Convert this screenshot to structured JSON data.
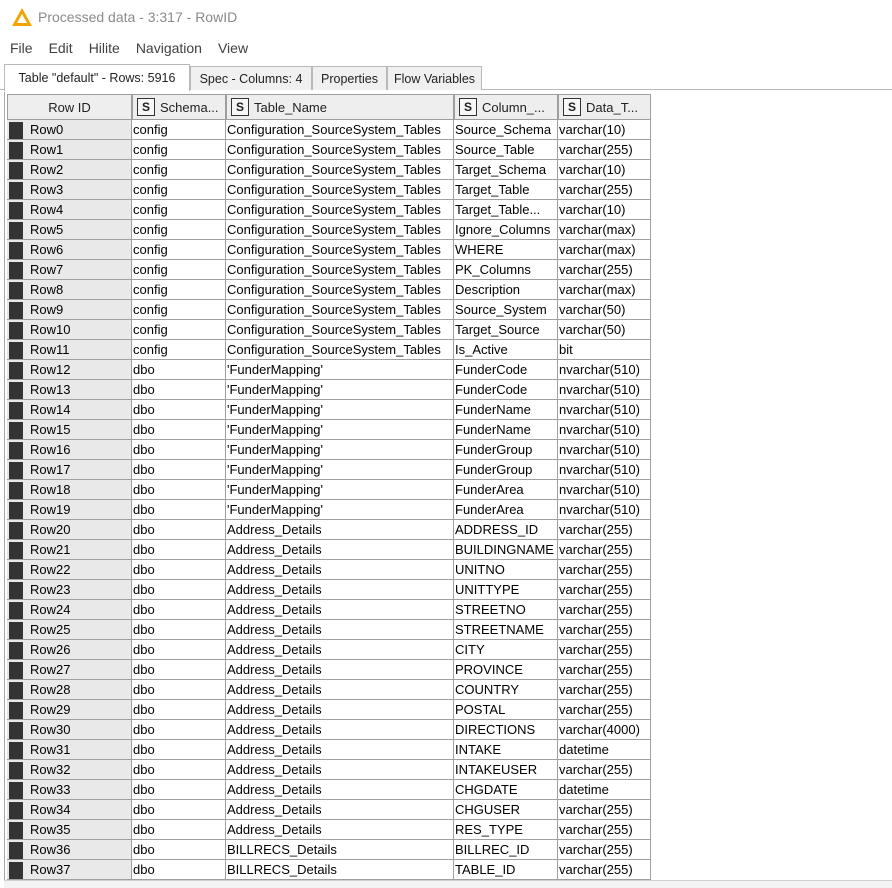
{
  "window": {
    "title": "Processed data - 3:317 - RowID",
    "warning_icon_color": "#f0a500"
  },
  "menu": [
    "File",
    "Edit",
    "Hilite",
    "Navigation",
    "View"
  ],
  "tabs": [
    {
      "label": "Table \"default\" - Rows: 5916",
      "active": true
    },
    {
      "label": "Spec - Columns: 4",
      "active": false
    },
    {
      "label": "Properties",
      "active": false
    },
    {
      "label": "Flow Variables",
      "active": false
    }
  ],
  "table": {
    "row_id_header": "Row ID",
    "columns": [
      {
        "type_badge": "S",
        "label": "Schema..."
      },
      {
        "type_badge": "S",
        "label": "Table_Name"
      },
      {
        "type_badge": "S",
        "label": "Column_..."
      },
      {
        "type_badge": "S",
        "label": "Data_T..."
      }
    ],
    "rows": [
      [
        "Row0",
        "config",
        "Configuration_SourceSystem_Tables",
        "Source_Schema",
        "varchar(10)"
      ],
      [
        "Row1",
        "config",
        "Configuration_SourceSystem_Tables",
        "Source_Table",
        "varchar(255)"
      ],
      [
        "Row2",
        "config",
        "Configuration_SourceSystem_Tables",
        "Target_Schema",
        "varchar(10)"
      ],
      [
        "Row3",
        "config",
        "Configuration_SourceSystem_Tables",
        "Target_Table",
        "varchar(255)"
      ],
      [
        "Row4",
        "config",
        "Configuration_SourceSystem_Tables",
        "Target_Table...",
        "varchar(10)"
      ],
      [
        "Row5",
        "config",
        "Configuration_SourceSystem_Tables",
        "Ignore_Columns",
        "varchar(max)"
      ],
      [
        "Row6",
        "config",
        "Configuration_SourceSystem_Tables",
        "WHERE",
        "varchar(max)"
      ],
      [
        "Row7",
        "config",
        "Configuration_SourceSystem_Tables",
        "PK_Columns",
        "varchar(255)"
      ],
      [
        "Row8",
        "config",
        "Configuration_SourceSystem_Tables",
        "Description",
        "varchar(max)"
      ],
      [
        "Row9",
        "config",
        "Configuration_SourceSystem_Tables",
        "Source_System",
        "varchar(50)"
      ],
      [
        "Row10",
        "config",
        "Configuration_SourceSystem_Tables",
        "Target_Source",
        "varchar(50)"
      ],
      [
        "Row11",
        "config",
        "Configuration_SourceSystem_Tables",
        "Is_Active",
        "bit"
      ],
      [
        "Row12",
        "dbo",
        "'FunderMapping'",
        "FunderCode",
        "nvarchar(510)"
      ],
      [
        "Row13",
        "dbo",
        "'FunderMapping'",
        "FunderCode",
        "nvarchar(510)"
      ],
      [
        "Row14",
        "dbo",
        "'FunderMapping'",
        "FunderName",
        "nvarchar(510)"
      ],
      [
        "Row15",
        "dbo",
        "'FunderMapping'",
        "FunderName",
        "nvarchar(510)"
      ],
      [
        "Row16",
        "dbo",
        "'FunderMapping'",
        "FunderGroup",
        "nvarchar(510)"
      ],
      [
        "Row17",
        "dbo",
        "'FunderMapping'",
        "FunderGroup",
        "nvarchar(510)"
      ],
      [
        "Row18",
        "dbo",
        "'FunderMapping'",
        "FunderArea",
        "nvarchar(510)"
      ],
      [
        "Row19",
        "dbo",
        "'FunderMapping'",
        "FunderArea",
        "nvarchar(510)"
      ],
      [
        "Row20",
        "dbo",
        "Address_Details",
        "ADDRESS_ID",
        "varchar(255)"
      ],
      [
        "Row21",
        "dbo",
        "Address_Details",
        "BUILDINGNAME",
        "varchar(255)"
      ],
      [
        "Row22",
        "dbo",
        "Address_Details",
        "UNITNO",
        "varchar(255)"
      ],
      [
        "Row23",
        "dbo",
        "Address_Details",
        "UNITTYPE",
        "varchar(255)"
      ],
      [
        "Row24",
        "dbo",
        "Address_Details",
        "STREETNO",
        "varchar(255)"
      ],
      [
        "Row25",
        "dbo",
        "Address_Details",
        "STREETNAME",
        "varchar(255)"
      ],
      [
        "Row26",
        "dbo",
        "Address_Details",
        "CITY",
        "varchar(255)"
      ],
      [
        "Row27",
        "dbo",
        "Address_Details",
        "PROVINCE",
        "varchar(255)"
      ],
      [
        "Row28",
        "dbo",
        "Address_Details",
        "COUNTRY",
        "varchar(255)"
      ],
      [
        "Row29",
        "dbo",
        "Address_Details",
        "POSTAL",
        "varchar(255)"
      ],
      [
        "Row30",
        "dbo",
        "Address_Details",
        "DIRECTIONS",
        "varchar(4000)"
      ],
      [
        "Row31",
        "dbo",
        "Address_Details",
        "INTAKE",
        "datetime"
      ],
      [
        "Row32",
        "dbo",
        "Address_Details",
        "INTAKEUSER",
        "varchar(255)"
      ],
      [
        "Row33",
        "dbo",
        "Address_Details",
        "CHGDATE",
        "datetime"
      ],
      [
        "Row34",
        "dbo",
        "Address_Details",
        "CHGUSER",
        "varchar(255)"
      ],
      [
        "Row35",
        "dbo",
        "Address_Details",
        "RES_TYPE",
        "varchar(255)"
      ],
      [
        "Row36",
        "dbo",
        "BILLRECS_Details",
        "BILLREC_ID",
        "varchar(255)"
      ],
      [
        "Row37",
        "dbo",
        "BILLRECS_Details",
        "TABLE_ID",
        "varchar(255)"
      ]
    ]
  }
}
